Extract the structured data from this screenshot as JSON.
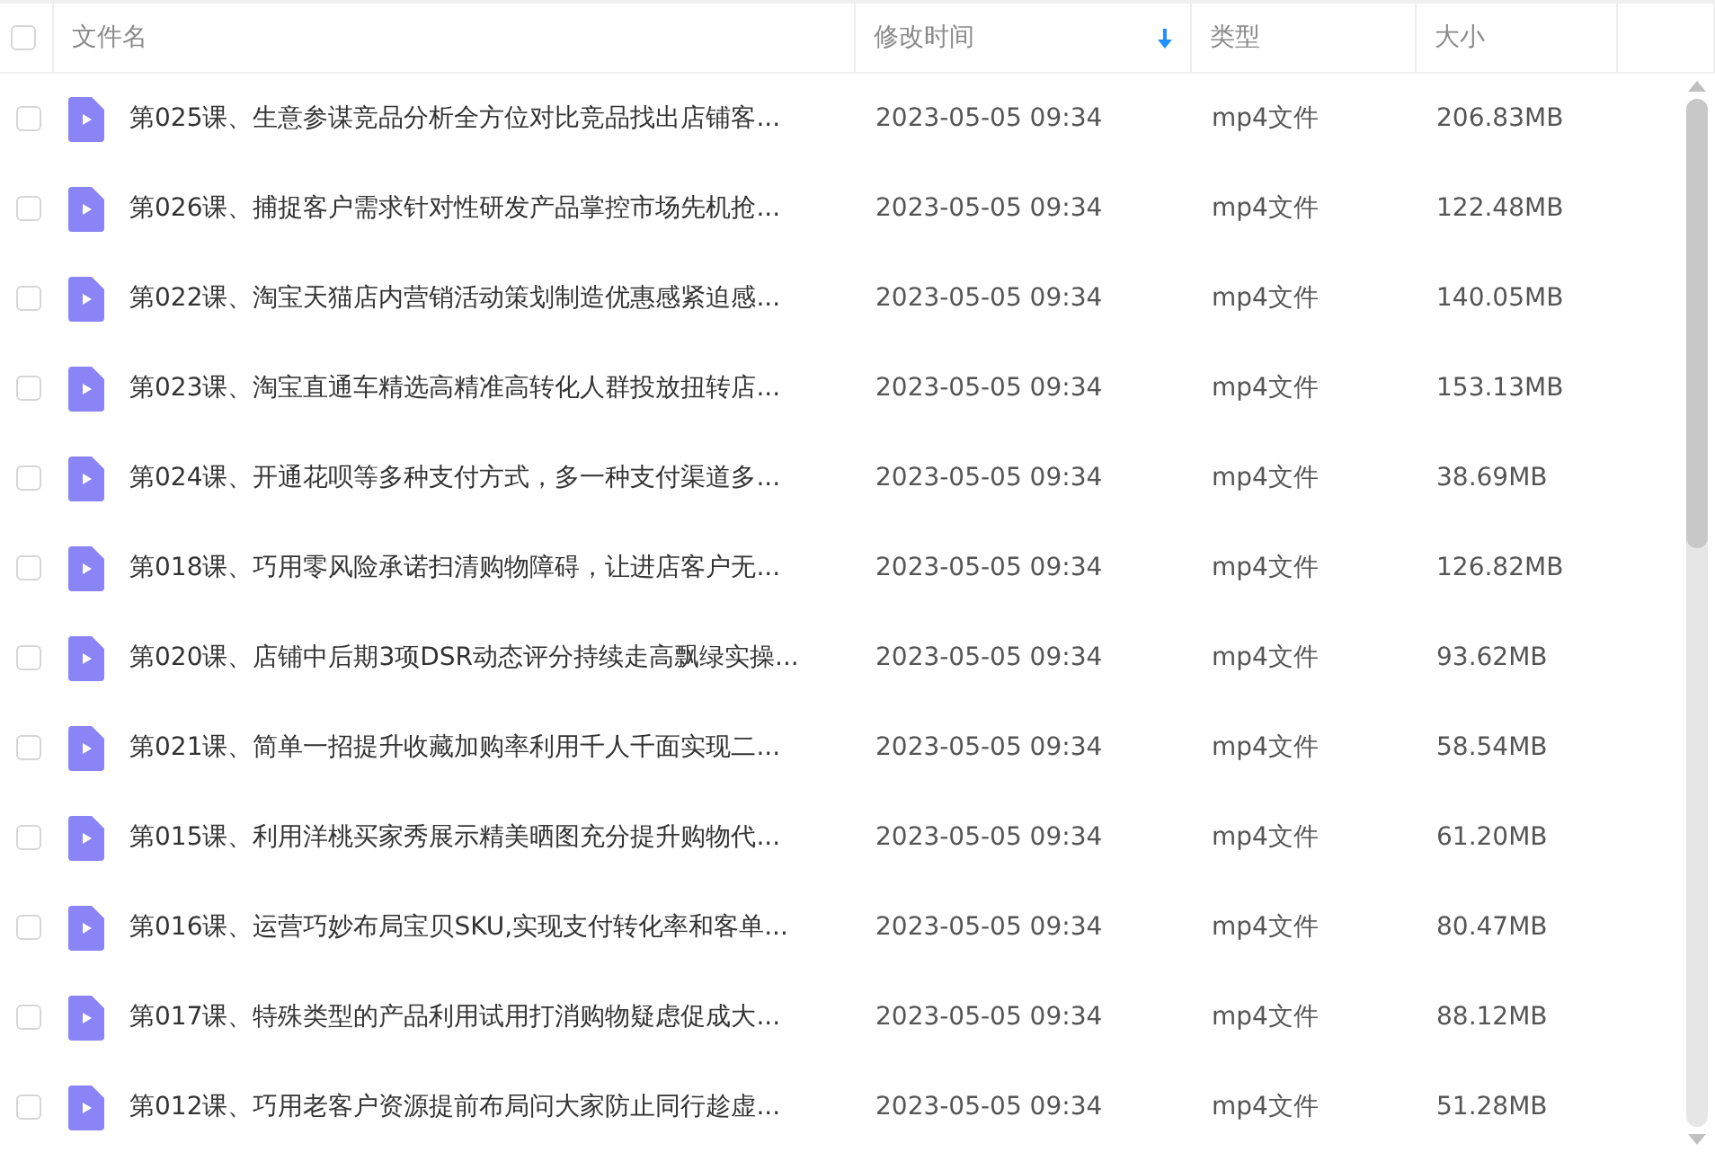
{
  "header": {
    "checked": false,
    "columns": [
      {
        "label": "文件名",
        "sorted": false
      },
      {
        "label": "修改时间",
        "sorted": true
      },
      {
        "label": "类型",
        "sorted": false
      },
      {
        "label": "大小",
        "sorted": false
      }
    ]
  },
  "rows": [
    {
      "checked": false,
      "name": "第025课、生意参谋竞品分析全方位对比竞品找出店铺客...",
      "modified": "2023-05-05 09:34",
      "type": "mp4文件",
      "size": "206.83MB"
    },
    {
      "checked": false,
      "name": "第026课、捕捉客户需求针对性研发产品掌控市场先机抢...",
      "modified": "2023-05-05 09:34",
      "type": "mp4文件",
      "size": "122.48MB"
    },
    {
      "checked": false,
      "name": "第022课、淘宝天猫店内营销活动策划制造优惠感紧迫感...",
      "modified": "2023-05-05 09:34",
      "type": "mp4文件",
      "size": "140.05MB"
    },
    {
      "checked": false,
      "name": "第023课、淘宝直通车精选高精准高转化人群投放扭转店...",
      "modified": "2023-05-05 09:34",
      "type": "mp4文件",
      "size": "153.13MB"
    },
    {
      "checked": false,
      "name": "第024课、开通花呗等多种支付方式，多一种支付渠道多...",
      "modified": "2023-05-05 09:34",
      "type": "mp4文件",
      "size": "38.69MB"
    },
    {
      "checked": false,
      "name": "第018课、巧用零风险承诺扫清购物障碍，让进店客户无...",
      "modified": "2023-05-05 09:34",
      "type": "mp4文件",
      "size": "126.82MB"
    },
    {
      "checked": false,
      "name": "第020课、店铺中后期3项DSR动态评分持续走高飘绿实操...",
      "modified": "2023-05-05 09:34",
      "type": "mp4文件",
      "size": "93.62MB"
    },
    {
      "checked": false,
      "name": "第021课、简单一招提升收藏加购率利用千人千面实现二...",
      "modified": "2023-05-05 09:34",
      "type": "mp4文件",
      "size": "58.54MB"
    },
    {
      "checked": false,
      "name": "第015课、利用洋桃买家秀展示精美晒图充分提升购物代...",
      "modified": "2023-05-05 09:34",
      "type": "mp4文件",
      "size": "61.20MB"
    },
    {
      "checked": false,
      "name": "第016课、运营巧妙布局宝贝SKU,实现支付转化率和客单...",
      "modified": "2023-05-05 09:34",
      "type": "mp4文件",
      "size": "80.47MB"
    },
    {
      "checked": false,
      "name": "第017课、特殊类型的产品利用试用打消购物疑虑促成大...",
      "modified": "2023-05-05 09:34",
      "type": "mp4文件",
      "size": "88.12MB"
    },
    {
      "checked": false,
      "name": "第012课、巧用老客户资源提前布局问大家防止同行趁虚...",
      "modified": "2023-05-05 09:34",
      "type": "mp4文件",
      "size": "51.28MB"
    }
  ]
}
